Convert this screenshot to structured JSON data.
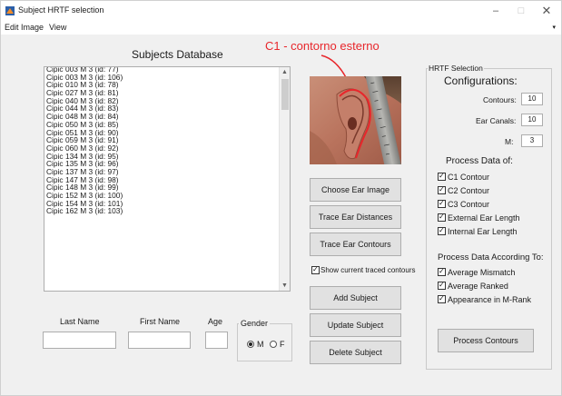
{
  "window": {
    "title": "Subject HRTF selection"
  },
  "titlebar_buttons": {
    "minimize": "–",
    "maximize": "□",
    "close": "✕"
  },
  "menubar": {
    "items": [
      "Edit",
      "Image",
      "View"
    ],
    "overflow": "▾"
  },
  "database": {
    "title": "Subjects Database",
    "items": [
      "Cipic 003 M 3 (id: 77)",
      "Cipic 003 M 3 (id: 106)",
      "Cipic 010 M 3 (id: 78)",
      "Cipic 027 M 3 (id: 81)",
      "Cipic 040 M 3 (id: 82)",
      "Cipic 044 M 3 (id: 83)",
      "Cipic 048 M 3 (id: 84)",
      "Cipic 050 M 3 (id: 85)",
      "Cipic 051 M 3 (id: 90)",
      "Cipic 059 M 3 (id: 91)",
      "Cipic 060 M 3 (id: 92)",
      "Cipic 134 M 3 (id: 95)",
      "Cipic 135 M 3 (id: 96)",
      "Cipic 137 M 3 (id: 97)",
      "Cipic 147 M 3 (id: 98)",
      "Cipic 148 M 3 (id: 99)",
      "Cipic 152 M 3 (id: 100)",
      "Cipic 154 M 3 (id: 101)",
      "Cipic 162 M 3 (id: 103)"
    ]
  },
  "form": {
    "last_name_label": "Last Name",
    "first_name_label": "First Name",
    "age_label": "Age",
    "last_name_value": "",
    "first_name_value": "",
    "age_value": "",
    "gender": {
      "label": "Gender",
      "options": [
        "M",
        "F"
      ],
      "selected": "M"
    }
  },
  "annotation": {
    "text": "C1 - contorno esterno",
    "color": "#e8262b"
  },
  "actions": {
    "choose_ear_image": "Choose Ear Image",
    "trace_ear_distances": "Trace Ear Distances",
    "trace_ear_contours": "Trace Ear Contours",
    "show_traced_contours": "Show current traced contours",
    "show_traced_contours_checked": true,
    "add_subject": "Add Subject",
    "update_subject": "Update Subject",
    "delete_subject": "Delete Subject"
  },
  "hrtf": {
    "panel_title": "HRTF Selection",
    "configurations_title": "Configurations:",
    "contours_label": "Contours:",
    "contours_value": "10",
    "ear_canals_label": "Ear Canals:",
    "ear_canals_value": "10",
    "m_label": "M:",
    "m_value": "3",
    "process_data_title": "Process Data of:",
    "process_items": [
      {
        "label": "C1 Contour",
        "checked": true
      },
      {
        "label": "C2 Contour",
        "checked": true
      },
      {
        "label": "C3 Contour",
        "checked": true
      },
      {
        "label": "External Ear Length",
        "checked": true
      },
      {
        "label": "Internal Ear Length",
        "checked": true
      }
    ],
    "according_title": "Process Data According To:",
    "according_items": [
      {
        "label": "Average Mismatch",
        "checked": true
      },
      {
        "label": "Average Ranked",
        "checked": true
      },
      {
        "label": "Appearance in M-Rank",
        "checked": true
      }
    ],
    "process_button": "Process Contours"
  },
  "colors": {
    "window_bg": "#f0f0f0",
    "button_bg": "#e1e1e1",
    "accent_red": "#e8262b"
  }
}
